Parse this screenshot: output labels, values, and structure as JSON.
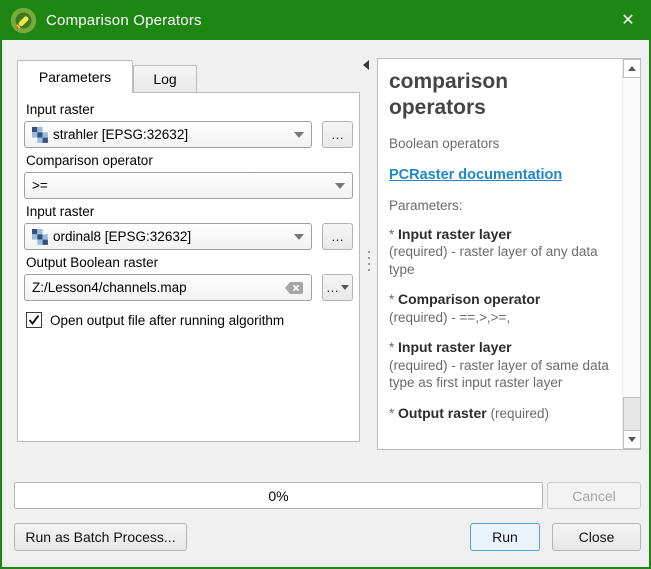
{
  "window": {
    "title": "Comparison Operators",
    "close_icon": "✕"
  },
  "tabs": {
    "parameters": "Parameters",
    "log": "Log"
  },
  "form": {
    "input_raster_1": {
      "label": "Input raster",
      "value": "strahler [EPSG:32632]",
      "browse_label": "…"
    },
    "comparison_operator": {
      "label": "Comparison operator",
      "value": ">="
    },
    "input_raster_2": {
      "label": "Input raster",
      "value": "ordinal8 [EPSG:32632]",
      "browse_label": "…"
    },
    "output_raster": {
      "label": "Output Boolean raster",
      "value": "Z:/Lesson4/channels.map",
      "browse_label": "…"
    },
    "open_output_checkbox": {
      "label": "Open output file after running algorithm",
      "checked": true
    }
  },
  "help": {
    "title": "comparison operators",
    "subtitle": "Boolean operators",
    "link_label": "PCRaster documentation",
    "section_heading": "Parameters:",
    "items": [
      {
        "bullet": "* ",
        "name": "Input raster layer",
        "desc": "(required) - raster layer of any data type"
      },
      {
        "bullet": "* ",
        "name": "Comparison operator",
        "desc": "(required) - ==,>,>=,"
      },
      {
        "bullet": "* ",
        "name": "Input raster layer",
        "desc": "(required) - raster layer of same data type as first input raster layer"
      },
      {
        "bullet": "* ",
        "name": "Output raster",
        "desc": " (required)"
      }
    ]
  },
  "footer": {
    "progress_label": "0%",
    "cancel_label": "Cancel",
    "batch_label": "Run as Batch Process...",
    "run_label": "Run",
    "close_label": "Close"
  },
  "colors": {
    "titlebar_green": "#1e8714",
    "link_blue": "#1f87c9",
    "run_accent": "#5a9fd4"
  }
}
